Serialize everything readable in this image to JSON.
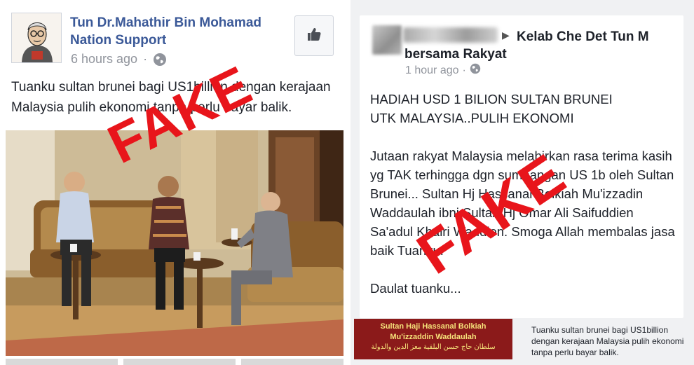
{
  "left_post": {
    "page_name": "Tun Dr.Mahathir Bin Mohamad Nation Support",
    "timestamp": "6 hours ago",
    "separator": "·",
    "text": "Tuanku sultan brunei bagi US1billion dengan kerajaan Malaysia pulih ekonomi tanpa perlu bayar balik.",
    "stamp": "FAKE"
  },
  "right_post": {
    "arrow": "▶",
    "group_name_line1": "Kelab Che Det Tun M",
    "group_name_line2": "bersama Rakyat",
    "timestamp": "1 hour ago",
    "separator": "·",
    "paragraphs": [
      "HADIAH USD 1 BILION SULTAN BRUNEI\nUTK MALAYSIA..PULIH EKONOMI",
      "Jutaan rakyat Malaysia melahirkan rasa terima kasih yg TAK terhingga dgn sumbangan US 1b oleh Sultan Brunei... Sultan Hj Hassanal Bolkiah Mu'izzadin Waddaulah ibni Sultan Hj Omar Ali Saifuddien Sa'adul Khairi Waddien. Smoga Allah membalas jasa baik Tuanku.",
      "Daulat tuanku..."
    ],
    "stamp": "FAKE",
    "banner": {
      "line1": "Sultan Haji Hassanal Bolkiah",
      "line2": "Mu'izzaddin Waddaulah",
      "line3": "سلطان حاج حسن البلقية معز الدين والدولة"
    },
    "caption": "Tuanku sultan brunei bagi US1billion dengan kerajaan Malaysia pulih ekonomi tanpa perlu bayar balik."
  },
  "colors": {
    "link_blue": "#3b5998",
    "meta_grey": "#90949c",
    "stamp_red": "#e8151b",
    "banner_red": "#8b1a1a"
  }
}
